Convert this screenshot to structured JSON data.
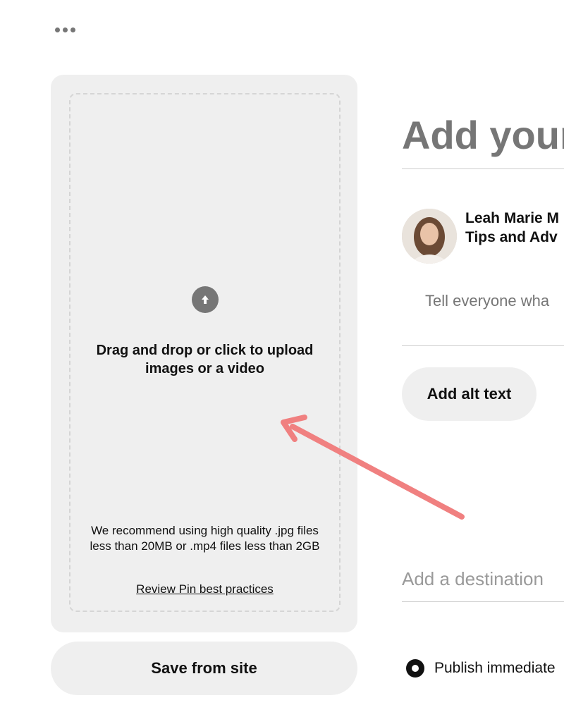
{
  "toolbar": {
    "more_icon": "more-horizontal-icon"
  },
  "upload": {
    "icon": "upload-arrow-icon",
    "instruction": "Drag and drop or click to upload images or a video",
    "recommendation": "We recommend using high quality .jpg files less than 20MB or .mp4 files less than 2GB",
    "best_practices_link": "Review Pin best practices"
  },
  "save_from_site": {
    "label": "Save from site"
  },
  "pin_form": {
    "title_placeholder": "Add your",
    "author": {
      "name_line1": "Leah Marie M",
      "name_line2": "Tips and Adv"
    },
    "description_placeholder": "Tell everyone wha",
    "alt_text_button": "Add alt text",
    "destination_placeholder": "Add a destination",
    "publish_option": "Publish immediate"
  },
  "colors": {
    "panel_bg": "#efefef",
    "dashed_border": "#d5d5d5",
    "annotation_arrow": "#f08080",
    "placeholder_text": "#767676"
  }
}
